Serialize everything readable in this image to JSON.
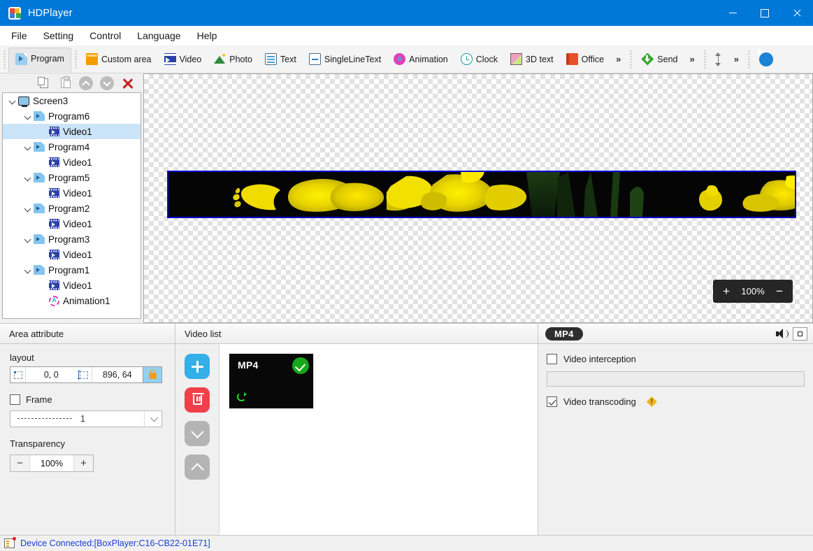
{
  "window": {
    "title": "HDPlayer",
    "logo_icon": "hdplayer-logo",
    "minimize_label": "Minimize",
    "maximize_label": "Maximize",
    "close_label": "Close"
  },
  "menubar": {
    "items": [
      {
        "label": "File"
      },
      {
        "label": "Setting"
      },
      {
        "label": "Control"
      },
      {
        "label": "Language"
      },
      {
        "label": "Help"
      }
    ]
  },
  "toolbar": {
    "groups": [
      {
        "buttons": [
          {
            "label": "Program",
            "icon": "program-icon",
            "active": true
          }
        ]
      },
      {
        "buttons": [
          {
            "label": "Custom area",
            "icon": "custom-area-icon"
          },
          {
            "label": "Video",
            "icon": "video-icon"
          },
          {
            "label": "Photo",
            "icon": "photo-icon"
          },
          {
            "label": "Text",
            "icon": "text-icon"
          },
          {
            "label": "SingleLineText",
            "icon": "single-line-text-icon"
          },
          {
            "label": "Animation",
            "icon": "animation-icon"
          },
          {
            "label": "Clock",
            "icon": "clock-icon"
          },
          {
            "label": "3D text",
            "icon": "3d-text-icon"
          },
          {
            "label": "Office",
            "icon": "office-icon"
          }
        ],
        "overflow": "»"
      },
      {
        "buttons": [
          {
            "label": "Send",
            "icon": "send-icon"
          }
        ],
        "overflow": "»"
      },
      {
        "buttons": [
          {
            "label": "",
            "icon": "updown-arrow-icon"
          }
        ],
        "overflow": "»"
      },
      {
        "buttons": [
          {
            "label": "",
            "icon": "play-icon"
          }
        ]
      }
    ]
  },
  "tree_toolbar": {
    "copy_label": "Copy",
    "paste_label": "Paste",
    "move_up_label": "Move up",
    "move_down_label": "Move down",
    "delete_label": "Delete"
  },
  "tree": {
    "nodes": [
      {
        "label": "Screen3",
        "icon": "screen-icon",
        "indent": 0,
        "expanded": true,
        "selected": false
      },
      {
        "label": "Program6",
        "icon": "program-icon",
        "indent": 1,
        "expanded": true,
        "selected": false
      },
      {
        "label": "Video1",
        "icon": "video-icon",
        "indent": 2,
        "expanded": false,
        "selected": true
      },
      {
        "label": "Program4",
        "icon": "program-icon",
        "indent": 1,
        "expanded": true,
        "selected": false
      },
      {
        "label": "Video1",
        "icon": "video-icon",
        "indent": 2,
        "expanded": false,
        "selected": false
      },
      {
        "label": "Program5",
        "icon": "program-icon",
        "indent": 1,
        "expanded": true,
        "selected": false
      },
      {
        "label": "Video1",
        "icon": "video-icon",
        "indent": 2,
        "expanded": false,
        "selected": false
      },
      {
        "label": "Program2",
        "icon": "program-icon",
        "indent": 1,
        "expanded": true,
        "selected": false
      },
      {
        "label": "Video1",
        "icon": "video-icon",
        "indent": 2,
        "expanded": false,
        "selected": false
      },
      {
        "label": "Program3",
        "icon": "program-icon",
        "indent": 1,
        "expanded": true,
        "selected": false
      },
      {
        "label": "Video1",
        "icon": "video-icon",
        "indent": 2,
        "expanded": false,
        "selected": false
      },
      {
        "label": "Program1",
        "icon": "program-icon",
        "indent": 1,
        "expanded": true,
        "selected": false
      },
      {
        "label": "Video1",
        "icon": "video-icon",
        "indent": 2,
        "expanded": false,
        "selected": false
      },
      {
        "label": "Animation1",
        "icon": "animation-icon",
        "indent": 2,
        "expanded": false,
        "selected": false
      }
    ]
  },
  "preview": {
    "zoom_in_label": "+",
    "zoom_value": "100%",
    "zoom_out_label": "−",
    "stage_border_color": "#0b0bd0",
    "stage_width": 896,
    "stage_height": 64,
    "content_description": "yellow daffodil flowers on black background"
  },
  "area_attribute": {
    "header": "Area attribute",
    "layout_label": "layout",
    "position_value": "0, 0",
    "size_value": "896, 64",
    "lock_icon": "lock-icon",
    "frame_label": "Frame",
    "frame_checked": false,
    "line_style_value": "1",
    "transparency_label": "Transparency",
    "transparency_value": "100%",
    "minus_label": "−",
    "plus_label": "+"
  },
  "video_list": {
    "header": "Video list",
    "add_label": "+",
    "delete_label": "Delete",
    "move_down_label": "Move down",
    "move_up_label": "Move up",
    "items": [
      {
        "label": "MP4",
        "selected": true,
        "loop": true
      }
    ]
  },
  "properties": {
    "tag": "MP4",
    "speaker_icon": "speaker-icon",
    "move_icon": "move-handle-icon",
    "video_interception_label": "Video interception",
    "video_interception_checked": false,
    "interception_value": "",
    "video_transcoding_label": "Video transcoding",
    "video_transcoding_checked": true,
    "warning_icon": "warning-icon"
  },
  "statusbar": {
    "icon": "device-icon",
    "text": "Device Connected:[BoxPlayer:C16-CB22-01E71]",
    "text_color": "#1b3fd6"
  }
}
